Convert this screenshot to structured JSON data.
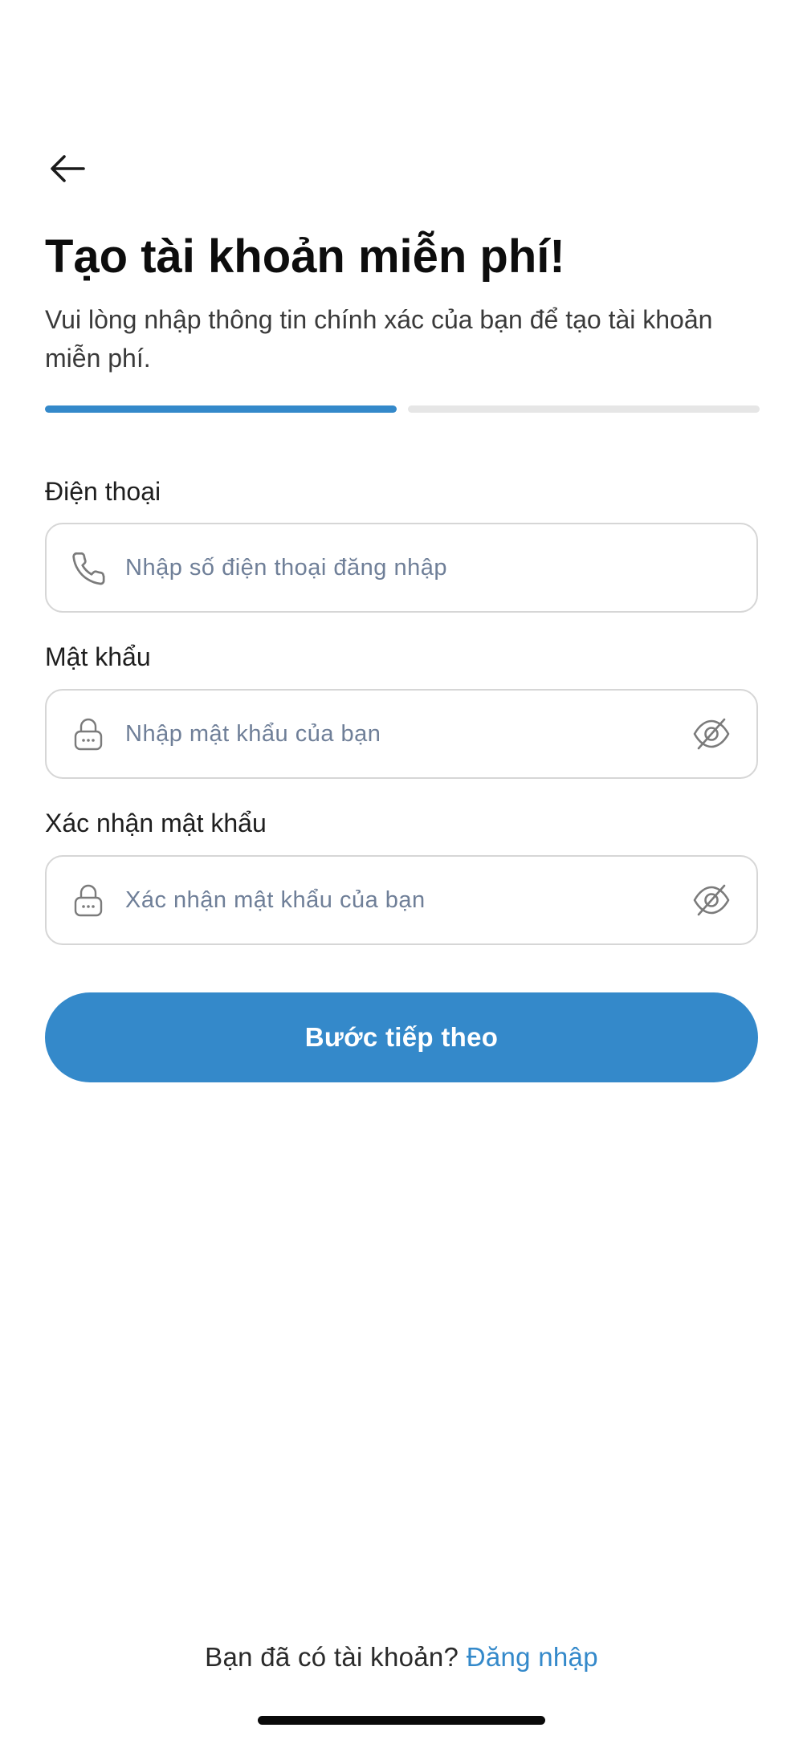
{
  "header": {
    "title": "Tạo tài khoản miễn phí!",
    "subtitle": "Vui lòng nhập thông tin chính xác của bạn để tạo tài khoản miễn phí."
  },
  "progress": {
    "current_step": 1,
    "total_steps": 2
  },
  "form": {
    "phone": {
      "label": "Điện thoại",
      "placeholder": "Nhập số điện thoại đăng nhập",
      "value": ""
    },
    "password": {
      "label": "Mật khẩu",
      "placeholder": "Nhập mật khẩu của bạn",
      "value": ""
    },
    "confirm_password": {
      "label": "Xác nhận mật khẩu",
      "placeholder": "Xác nhận mật khẩu của bạn",
      "value": ""
    },
    "submit_label": "Bước tiếp theo"
  },
  "footer": {
    "prompt": "Bạn đã có tài khoản?",
    "login_label": "Đăng nhập"
  },
  "icons": {
    "back": "arrow-left-icon",
    "phone": "phone-icon",
    "lock": "lock-icon",
    "toggle_visibility": "eye-off-icon"
  },
  "colors": {
    "primary": "#3489ca",
    "progress_inactive": "#e6e6e6",
    "placeholder": "#6f7f98",
    "field_border": "#d6d6d6"
  }
}
